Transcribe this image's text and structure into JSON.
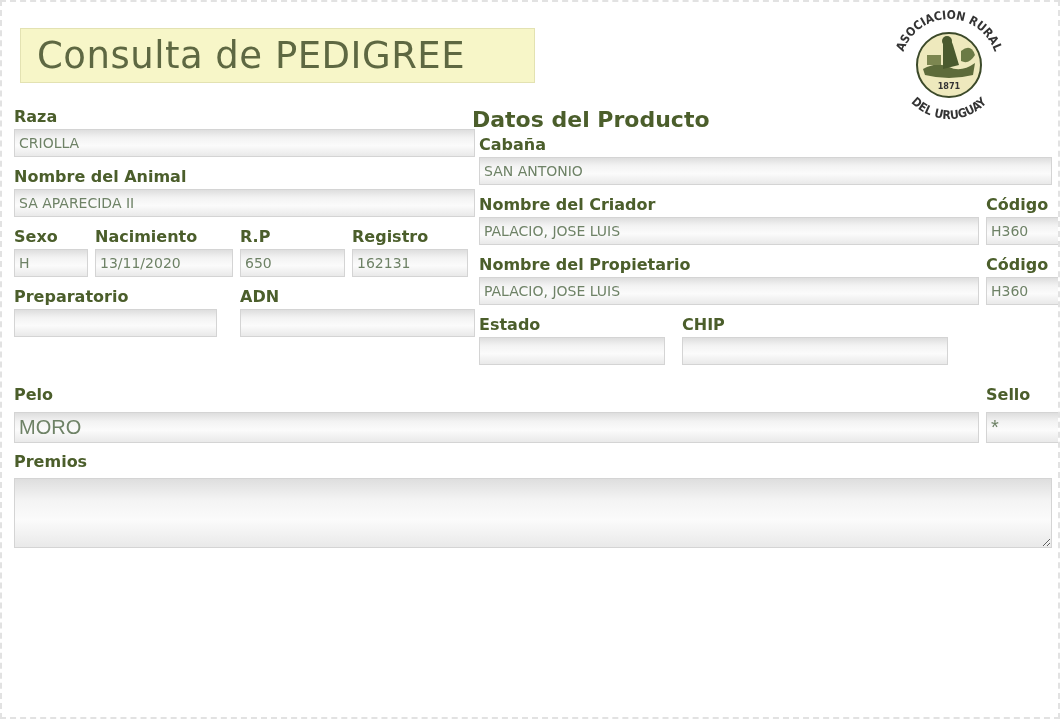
{
  "title": "Consulta de PEDIGREE",
  "logo": {
    "text_top": "ASOCIACION RURAL",
    "text_bottom": "DEL URUGUAY",
    "year": "1871"
  },
  "animal": {
    "raza": {
      "label": "Raza",
      "value": "CRIOLLA"
    },
    "nombre": {
      "label": "Nombre del Animal",
      "value": "SA APARECIDA II"
    },
    "sexo": {
      "label": "Sexo",
      "value": "H"
    },
    "nacimiento": {
      "label": "Nacimiento",
      "value": "13/11/2020"
    },
    "rp": {
      "label": "R.P",
      "value": "650"
    },
    "registro": {
      "label": "Registro",
      "value": "162131"
    },
    "preparatorio": {
      "label": "Preparatorio"
    },
    "adn": {
      "label": "ADN"
    }
  },
  "producto": {
    "heading": "Datos del Producto",
    "cabana": {
      "label": "Cabaña",
      "value": "SAN ANTONIO"
    },
    "criador": {
      "label": "Nombre del Criador",
      "value": "PALACIO, JOSE LUIS"
    },
    "criador_codigo": {
      "label": "Código",
      "value": "H360"
    },
    "propietario": {
      "label": "Nombre del Propietario",
      "value": "PALACIO, JOSE LUIS"
    },
    "propietario_codigo": {
      "label": "Código",
      "value": "H360"
    },
    "estado": {
      "label": "Estado"
    },
    "chip": {
      "label": "CHIP"
    }
  },
  "pelo": {
    "label": "Pelo",
    "value": "MORO"
  },
  "sello": {
    "label": "Sello",
    "value": "*"
  },
  "premios": {
    "label": "Premios"
  }
}
